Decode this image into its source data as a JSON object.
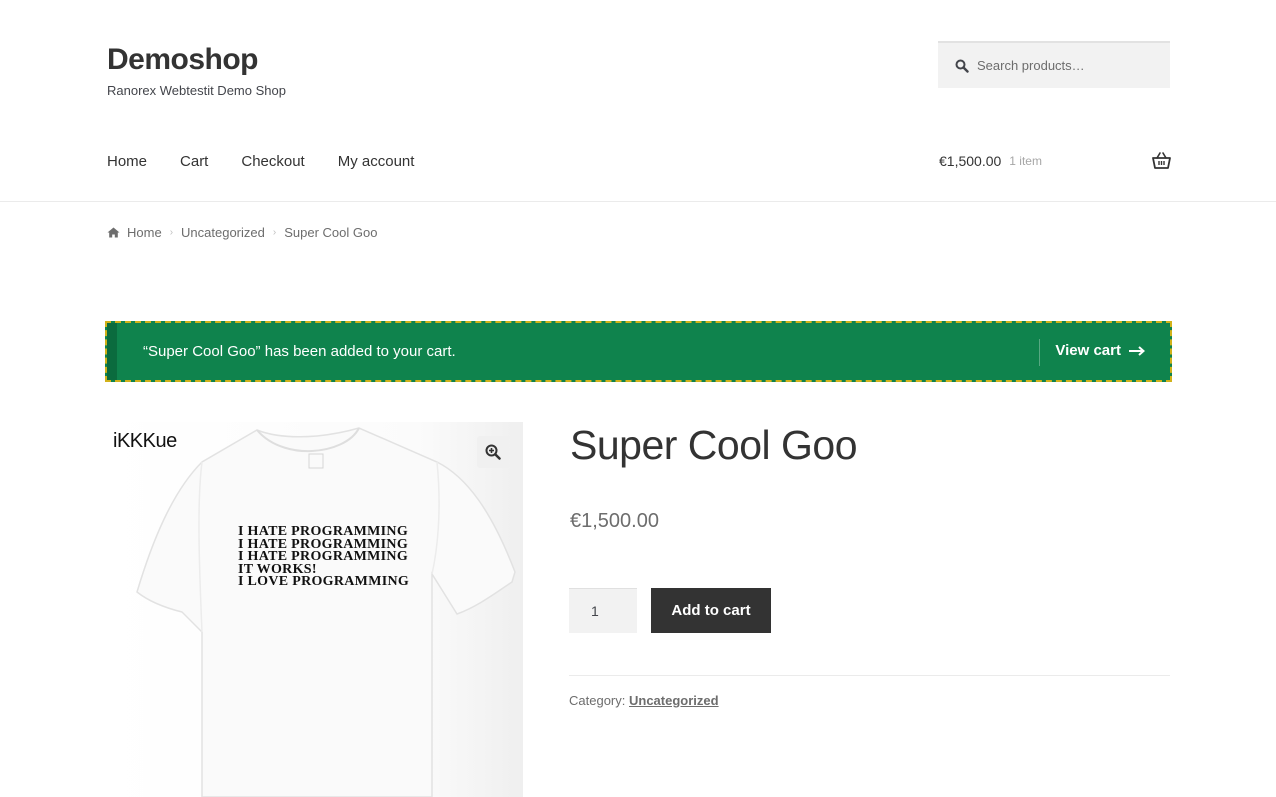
{
  "site": {
    "title": "Demoshop",
    "description": "Ranorex Webtestit Demo Shop"
  },
  "search": {
    "placeholder": "Search products…"
  },
  "nav": {
    "items": [
      "Home",
      "Cart",
      "Checkout",
      "My account"
    ]
  },
  "mini_cart": {
    "amount": "€1,500.00",
    "count": "1 item"
  },
  "breadcrumb": {
    "items": [
      "Home",
      "Uncategorized",
      "Super Cool Goo"
    ]
  },
  "notice": {
    "message": "“Super Cool Goo” has been added to your cart.",
    "action": "View cart"
  },
  "product": {
    "title": "Super Cool Goo",
    "price": "€1,500.00",
    "quantity": "1",
    "add_to_cart": "Add to cart",
    "category_label": "Category:",
    "category": "Uncategorized",
    "image_brand": "iKKKue",
    "shirt_lines": [
      "I HATE PROGRAMMING",
      "I HATE PROGRAMMING",
      "I HATE PROGRAMMING",
      "IT WORKS!",
      "I LOVE PROGRAMMING"
    ]
  },
  "colors": {
    "notice_bg": "#0f834d",
    "notice_border": "#d1b21a",
    "button_bg": "#333333"
  }
}
